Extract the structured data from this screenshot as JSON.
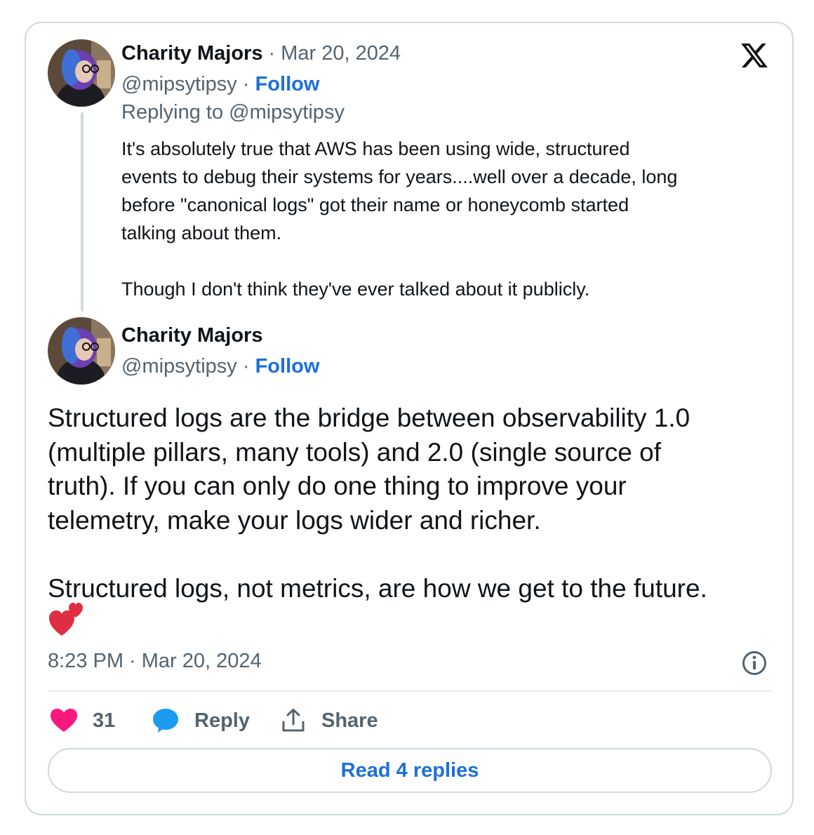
{
  "parent_tweet": {
    "author_name": "Charity Majors",
    "date": "· Mar 20, 2024",
    "handle": "@mipsytipsy",
    "separator": "·",
    "follow_label": "Follow",
    "replying_to": "Replying to @mipsytipsy",
    "text": "It's absolutely true that AWS has been using wide, structured\nevents to debug their systems for years....well over a decade, long\nbefore \"canonical logs\" got their name or honeycomb started\ntalking about them.\n\nThough I don't think they've ever talked about it publicly."
  },
  "main_tweet": {
    "author_name": "Charity Majors",
    "handle": "@mipsytipsy",
    "separator": "·",
    "follow_label": "Follow",
    "text": "Structured logs are the bridge between observability 1.0\n(multiple pillars, many tools) and 2.0 (single source of\ntruth). If you can only do one thing to improve your\ntelemetry, make your logs wider and richer.\n\nStructured logs, not metrics, are how we get to the future.",
    "emoji": "two-hearts-icon",
    "timestamp": "8:23 PM · Mar 20, 2024"
  },
  "actions": {
    "like_count": "31",
    "reply_label": "Reply",
    "share_label": "Share"
  },
  "read_replies_label": "Read 4 replies",
  "colors": {
    "link": "#1d6fd8",
    "muted": "#536471",
    "like": "#f91880",
    "reply_bubble": "#1d9bf0",
    "border": "#cfd9de"
  }
}
